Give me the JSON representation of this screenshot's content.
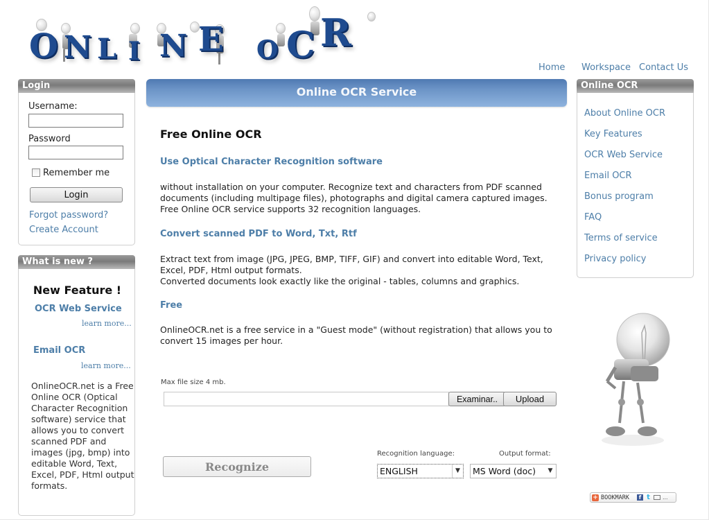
{
  "logo": {
    "letters": [
      "O",
      "N",
      "L",
      "I",
      "N",
      "E",
      "O",
      "C",
      "R"
    ],
    "alt": "ONLINE OCR"
  },
  "nav": {
    "home": "Home",
    "workspace": "Workspace",
    "contact": "Contact Us"
  },
  "login": {
    "title": "Login",
    "username_label": "Username:",
    "username_value": "",
    "password_label": "Password",
    "password_value": "",
    "remember_label": "Remember me",
    "remember_checked": false,
    "login_button": "Login",
    "forgot_link": "Forgot password?",
    "create_link": "Create Account"
  },
  "whats_new": {
    "title": "What is new ?",
    "feature_heading": "New Feature !",
    "features": [
      {
        "label": "OCR Web Service",
        "more": "learn more..."
      },
      {
        "label": "Email OCR",
        "more": "learn more..."
      }
    ],
    "promo": "OnlineOCR.net is a Free Online OCR (Optical Character Recognition software) service that allows you to convert scanned PDF and images (jpg, bmp) into editable Word, Text, Excel, PDF, Html output formats."
  },
  "main": {
    "header": "Online OCR Service",
    "title": "Free Online OCR",
    "sections": [
      {
        "heading": "Use Optical Character Recognition software",
        "body": "without installation on your computer. Recognize text and characters from PDF scanned documents (including multipage files), photographs and digital camera captured images. Free Online OCR service supports 32 recognition languages."
      },
      {
        "heading": "Convert scanned PDF to Word, Txt, Rtf",
        "body": "Extract text from image (JPG, JPEG, BMP, TIFF, GIF) and convert into editable Word, Text, Excel, PDF, Html output formats.",
        "body2": "Converted documents look exactly like the original - tables, columns and graphics."
      },
      {
        "heading": "Free",
        "body": "OnlineOCR.net is a free service in a \"Guest mode\" (without registration) that allows you to convert 15 images per hour."
      }
    ],
    "upload": {
      "max_size_label": "Max file size 4 mb.",
      "file_value": "",
      "browse_button": "Examinar..",
      "upload_button": "Upload"
    },
    "recognize_button": "Recognize",
    "language_label": "Recognition language:",
    "language_value": "ENGLISH",
    "format_label": "Output format:",
    "format_value": "MS Word (doc)"
  },
  "right_menu": {
    "title": "Online OCR",
    "items": [
      "About Online OCR",
      "Key Features",
      "OCR Web Service",
      "Email OCR",
      "Bonus program",
      "FAQ",
      "Terms of service",
      "Privacy policy"
    ]
  },
  "bookmark": {
    "label": "BOOKMARK",
    "more": "..."
  },
  "colors": {
    "link": "#4d7ea8",
    "header_blue": "#6b93c6",
    "box_head_gray": "#8a8a8a",
    "logo_blue": "#1f4b8f"
  }
}
